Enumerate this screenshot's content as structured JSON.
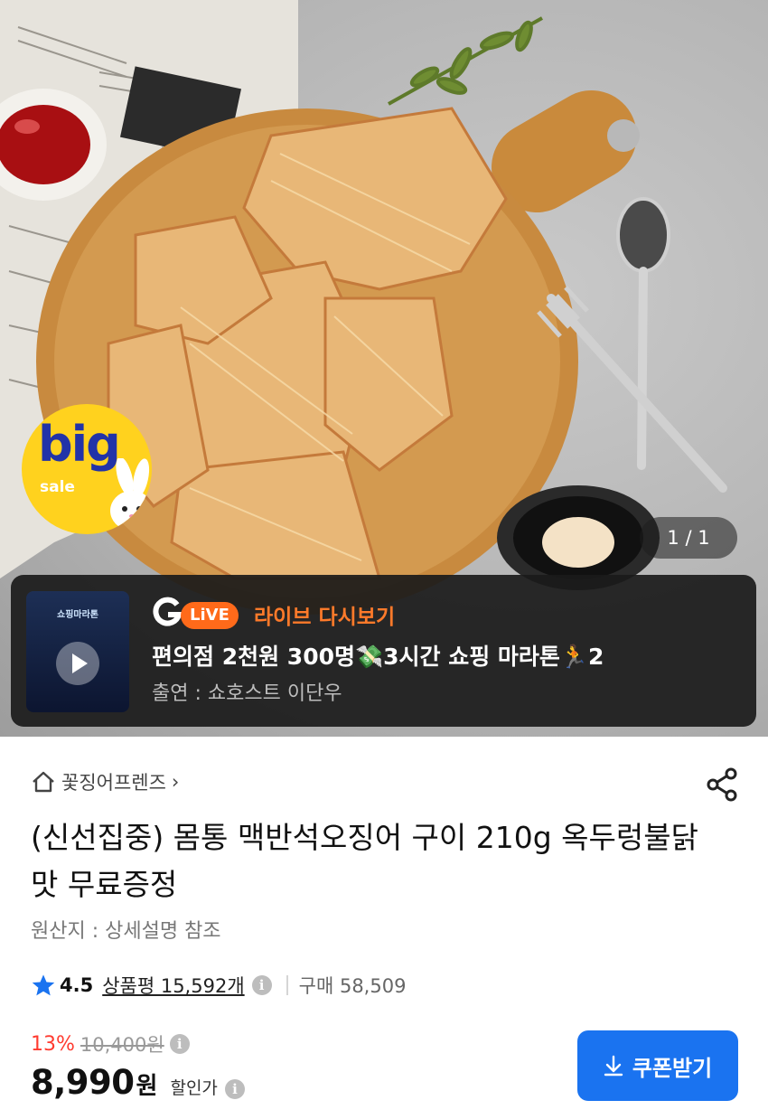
{
  "hero": {
    "badge": {
      "big": "big",
      "sale": "sale"
    },
    "counter": "1 / 1",
    "live": {
      "logo": "G",
      "pill": "LiVE",
      "replay_label": "라이브 다시보기",
      "title": "편의점 2천원 300명💸3시간 쇼핑 마라톤🏃2",
      "host": "출연 : 쇼호스트 이단우",
      "thumb_title": "쇼핑마라톤",
      "play_icon": "play-icon"
    }
  },
  "breadcrumb": {
    "store": "꽃징어프렌즈",
    "chevron": "›"
  },
  "product": {
    "title": "(신선집중) 몸통 맥반석오징어 구이 210g 옥두렁불닭맛 무료증정",
    "origin": "원산지 : 상세설명 참조"
  },
  "rating": {
    "score": "4.5",
    "review_label": "상품평 15,592개",
    "buy_label": "구매 58,509",
    "info_glyph": "i"
  },
  "price": {
    "discount_rate": "13%",
    "original": "10,400원",
    "sale": "8,990",
    "unit": "원",
    "label": "할인가",
    "info_glyph": "i"
  },
  "coupon": {
    "label": "쿠폰받기"
  },
  "colors": {
    "accent": "#1a73f0",
    "discount": "#ff3b30",
    "live_orange": "#ff6a1a",
    "badge_yellow": "#ffd21e",
    "badge_blue": "#2233a8"
  }
}
